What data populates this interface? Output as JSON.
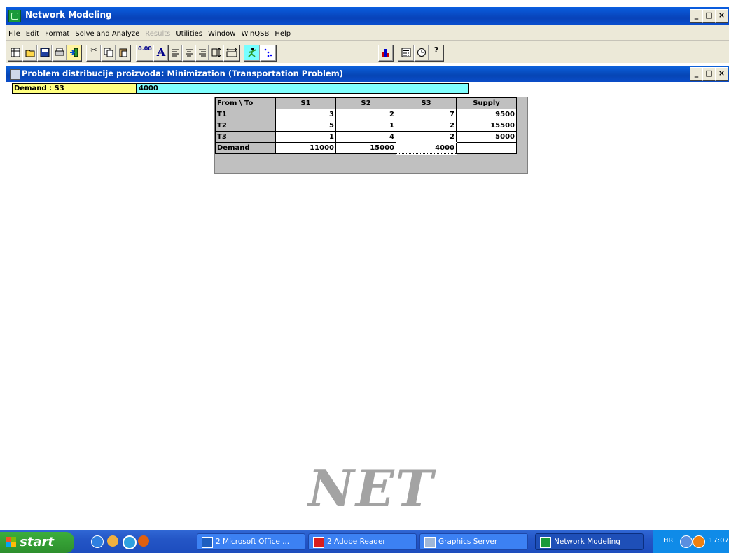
{
  "window": {
    "title": "Network Modeling",
    "min_label": "_",
    "max_label": "□",
    "close_label": "×"
  },
  "menu": [
    "File",
    "Edit",
    "Format",
    "Solve and Analyze",
    "Results",
    "Utilities",
    "Window",
    "WinQSB",
    "Help"
  ],
  "menu_disabled": [
    "Results"
  ],
  "toolbar": {
    "icons": [
      "new-icon",
      "open-icon",
      "save-icon",
      "print-icon",
      "exit-icon",
      "cut-icon",
      "copy-icon",
      "paste-icon",
      "number-format-icon",
      "font-icon",
      "align-left-icon",
      "align-center-icon",
      "align-right-icon",
      "row-height-icon",
      "column-width-icon",
      "solve-icon",
      "graph-icon",
      "bar-chart-icon",
      "calculator-icon",
      "clock-icon",
      "help-icon"
    ],
    "number_label": "0.00",
    "font_label": "A",
    "help_label": "?"
  },
  "child_window": {
    "title": "Problem distribucije proizvoda: Minimization (Transportation Problem)"
  },
  "edit_line": {
    "cell_label": "Demand : S3",
    "cell_value": "4000"
  },
  "grid": {
    "headers": [
      "From \\ To",
      "S1",
      "S2",
      "S3",
      "Supply"
    ],
    "rows": [
      {
        "label": "T1",
        "values": [
          "3",
          "2",
          "7",
          "9500"
        ]
      },
      {
        "label": "T2",
        "values": [
          "5",
          "1",
          "2",
          "15500"
        ]
      },
      {
        "label": "T3",
        "values": [
          "1",
          "4",
          "2",
          "5000"
        ]
      },
      {
        "label": "Demand",
        "values": [
          "11000",
          "15000",
          "4000",
          ""
        ]
      }
    ],
    "selected_cell": "Demand:S3"
  },
  "watermark": "NET",
  "taskbar": {
    "start_label": "start",
    "tasks": [
      {
        "label": "2 Microsoft Office ...",
        "icon": "office-icon"
      },
      {
        "label": "2 Adobe Reader",
        "icon": "adobe-icon"
      },
      {
        "label": "Graphics Server",
        "icon": "graphics-server-icon"
      },
      {
        "label": "Network Modeling",
        "icon": "network-modeling-icon",
        "active": true
      }
    ],
    "language": "HR",
    "clock": "17:07"
  }
}
